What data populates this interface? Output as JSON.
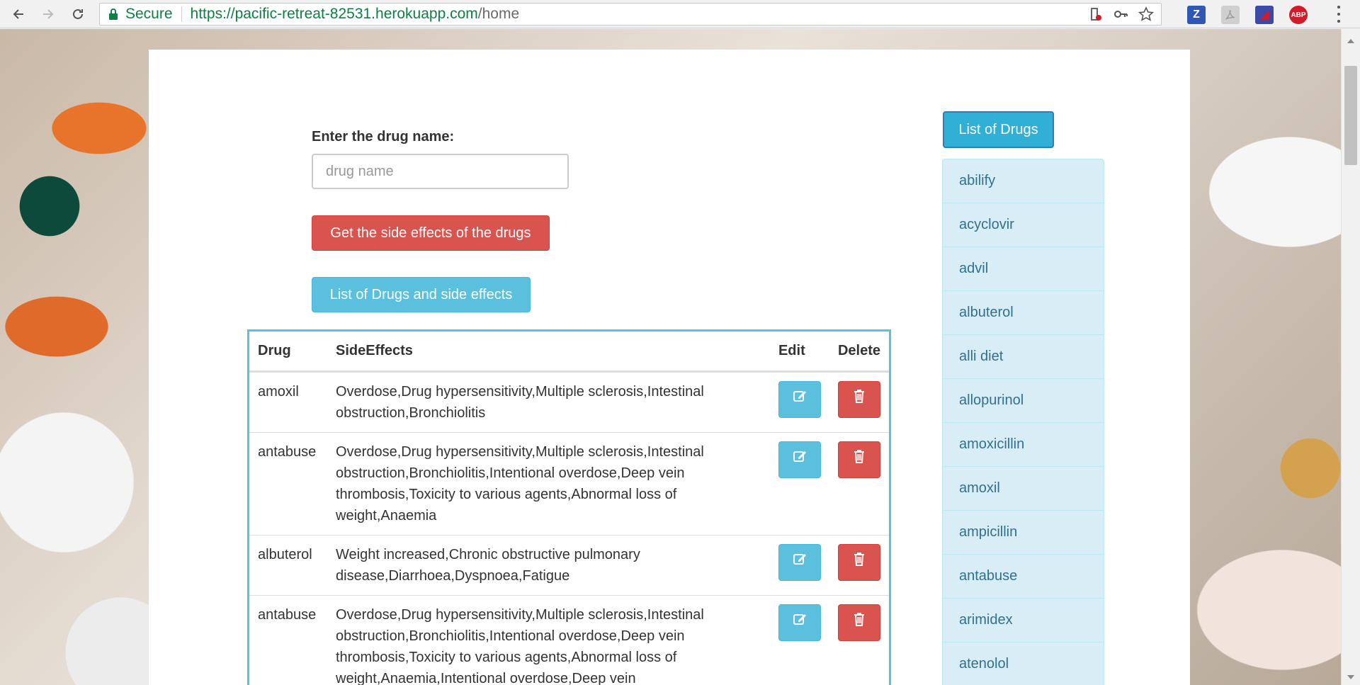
{
  "browser": {
    "secure_label": "Secure",
    "url_host": "https://pacific-retreat-82531.herokuapp.com",
    "url_path": "/home",
    "extensions": [
      "Z",
      "",
      "",
      "ABP"
    ]
  },
  "form": {
    "label": "Enter the drug name:",
    "placeholder": "drug name",
    "value": "",
    "submit_label": "Get the side effects of the drugs",
    "list_drugs_side_effects_label": "List of Drugs and side effects"
  },
  "sidebar": {
    "button_label": "List of Drugs",
    "items": [
      "abilify",
      "acyclovir",
      "advil",
      "albuterol",
      "alli diet",
      "allopurinol",
      "amoxicillin",
      "amoxil",
      "ampicillin",
      "antabuse",
      "arimidex",
      "atenolol"
    ]
  },
  "table": {
    "headers": {
      "drug": "Drug",
      "side_effects": "SideEffects",
      "edit": "Edit",
      "delete": "Delete"
    },
    "rows": [
      {
        "drug": "amoxil",
        "side_effects": "Overdose,Drug hypersensitivity,Multiple sclerosis,Intestinal obstruction,Bronchiolitis"
      },
      {
        "drug": "antabuse",
        "side_effects": "Overdose,Drug hypersensitivity,Multiple sclerosis,Intestinal obstruction,Bronchiolitis,Intentional overdose,Deep vein thrombosis,Toxicity to various agents,Abnormal loss of weight,Anaemia"
      },
      {
        "drug": "albuterol",
        "side_effects": "Weight increased,Chronic obstructive pulmonary disease,Diarrhoea,Dyspnoea,Fatigue"
      },
      {
        "drug": "antabuse",
        "side_effects": "Overdose,Drug hypersensitivity,Multiple sclerosis,Intestinal obstruction,Bronchiolitis,Intentional overdose,Deep vein thrombosis,Toxicity to various agents,Abnormal loss of weight,Anaemia,Intentional overdose,Deep vein"
      }
    ]
  },
  "colors": {
    "danger": "#d9534f",
    "info": "#5bc0de",
    "list_bg": "#d9edf7",
    "list_text": "#31708f",
    "secure_green": "#0b8043"
  }
}
